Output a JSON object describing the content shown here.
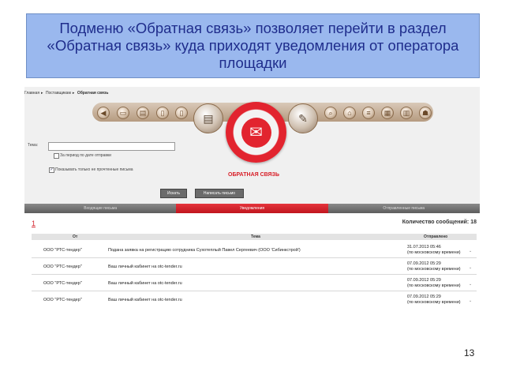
{
  "banner": {
    "text": "Подменю «Обратная связь» позволяет перейти в раздел «Обратная связь» куда приходят уведомления от оператора площадки"
  },
  "breadcrumb": [
    "Главная",
    "Поставщикам",
    "Обратная связь"
  ],
  "toolbar": {
    "section_label": "ОБРАТНАЯ СВЯЗЬ"
  },
  "form": {
    "topic_label": "Тема:",
    "topic_value": "",
    "period_checkbox_label": "За период по дате отправки",
    "unread_checkbox_label": "Показывать только не прочтенные письма",
    "search_button": "Искать",
    "write_button": "Написать письмо"
  },
  "tabs": [
    {
      "label": "Входящие письма",
      "active": false
    },
    {
      "label": "Уведомления",
      "active": true
    },
    {
      "label": "Отправленные письма",
      "active": false
    }
  ],
  "results": {
    "page": "1",
    "count_label": "Количество сообщений: 18",
    "columns": [
      "От",
      "Тема",
      "Отправлено"
    ],
    "rows": [
      {
        "from": "ООО \"РТС-тендер\"",
        "subject": "Подана заявка на регистрацию сотрудника Сухотеплый Павел Сергеевич (ООО 'Сибинкстрой')",
        "date": "31.07.2013 05:46",
        "tz": "(по московскому времени)"
      },
      {
        "from": "ООО \"РТС-тендер\"",
        "subject": "Ваш личный кабинет на otc-tender.ru",
        "date": "07.09.2012 05:29",
        "tz": "(по московскому времени)"
      },
      {
        "from": "ООО \"РТС-тендер\"",
        "subject": "Ваш личный кабинет на otc-tender.ru",
        "date": "07.09.2012 05:29",
        "tz": "(по московскому времени)"
      },
      {
        "from": "ООО \"РТС-тендер\"",
        "subject": "Ваш личный кабинет на otc-tender.ru",
        "date": "07.09.2012 05:29",
        "tz": "(по московскому времени)"
      }
    ]
  },
  "page_number": "13",
  "colors": {
    "accent": "#e2242f",
    "banner_bg": "#9ab8ee",
    "banner_text": "#1f2d8c"
  }
}
